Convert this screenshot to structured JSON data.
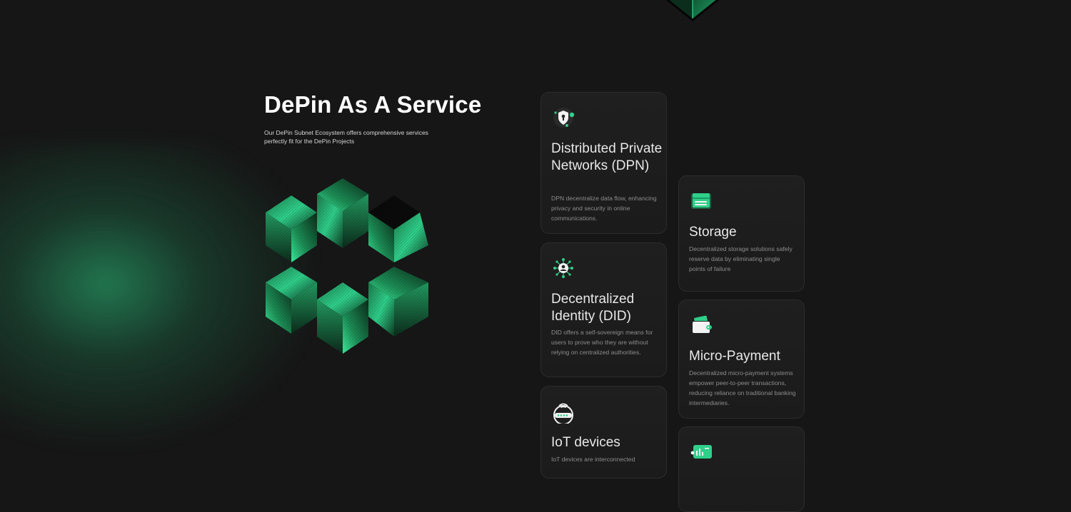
{
  "hero": {
    "title": "DePin As A Service",
    "subtitle": "Our DePin Subnet Ecosystem offers comprehensive services perfectly fit for the DePin Projects"
  },
  "services": [
    {
      "title": "Distributed Private Networks (DPN)",
      "description": "DPN decentralize data flow, enhancing privacy and security in online communications.",
      "icon": "shield-lock-icon"
    },
    {
      "title": "Decentralized Identity (DID)",
      "description": "DID offers a self-sovereign means for users to prove who they are without relying on centralized authorities.",
      "icon": "identity-network-icon"
    },
    {
      "title": "IoT devices",
      "description": "IoT devices are interconnected",
      "icon": "router-icon"
    },
    {
      "title": "Storage",
      "description": "Decentralized storage solutions safely reserve data by eliminating single points of failure",
      "icon": "storage-icon"
    },
    {
      "title": "Micro-Payment",
      "description": "Decentralized micro-payment systems empower peer-to-peer transactions, reducing reliance on traditional banking intermediaries.",
      "icon": "wallet-icon"
    },
    {
      "title": "",
      "description": "",
      "icon": "analytics-icon"
    }
  ],
  "colors": {
    "background": "#161616",
    "accent": "#2fd08a",
    "card": "#1d1d1d"
  }
}
